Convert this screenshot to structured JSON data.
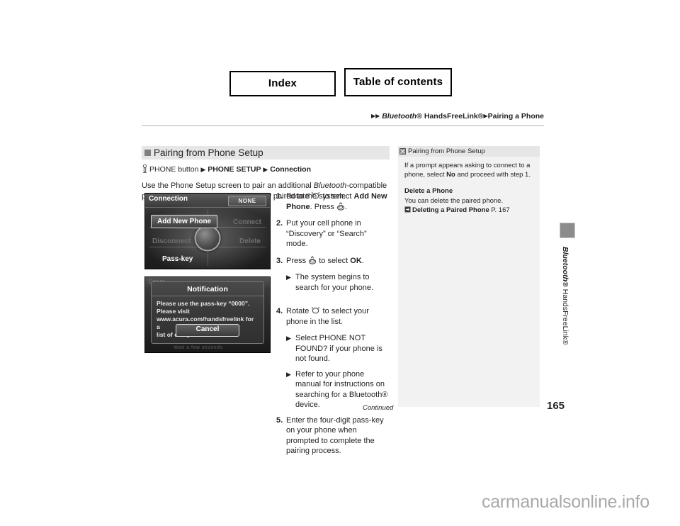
{
  "topnav": {
    "index_label": "Index",
    "toc_label": "Table of contents"
  },
  "breadcrumb": {
    "tri1": "▶",
    "tri2": "▶",
    "bluetooth": "Bluetooth",
    "reg1": "®",
    "handsfreelink": " HandsFreeLink",
    "reg2": "®",
    "tri3": "▶",
    "page": "Pairing a Phone"
  },
  "section": {
    "header_title": "Pairing from Phone Setup",
    "nav_phone_button": "PHONE button",
    "nav_tri1": "▶",
    "nav_phone_setup": "PHONE SETUP",
    "nav_tri2": "▶",
    "nav_connection": "Connection",
    "intro_a": "Use the Phone Setup screen to pair an additional ",
    "intro_italic": "Bluetooth",
    "intro_b": "-compatible phone if a phone has been previously paired to the system."
  },
  "screens": {
    "connection": {
      "title": "Connection",
      "status": "NONE",
      "btn_add_new_phone": "Add New Phone",
      "btn_connect": "Connect",
      "btn_disconnect": "Disconnect",
      "btn_delete": "Delete",
      "btn_pass_key": "Pass-key"
    },
    "notification": {
      "behind_title": "Setup",
      "title": "Notification",
      "line1": "Please use the pass-key “0000”.",
      "line2": "Please visit",
      "line3": "www.acura.com/handsfreelink for a",
      "line4": "list of compatible devices.",
      "cancel_label": "Cancel",
      "behind_bottom": "Wait a few seconds"
    }
  },
  "steps": [
    {
      "num": "1.",
      "pre": "Rotate ",
      "icon": "rotate-knob-icon",
      "mid": " to select ",
      "bold": "Add New Phone",
      "post": ". Press ",
      "icon2": "press-knob-icon",
      "end": "."
    },
    {
      "num": "2.",
      "text": "Put your cell phone in “Discovery” or “Search” mode."
    },
    {
      "num": "3.",
      "pre": "Press ",
      "icon": "press-knob-icon",
      "mid": " to select ",
      "bold": "OK",
      "post": ".",
      "sub": [
        {
          "tri": "▶",
          "text": "The system begins to search for your phone."
        }
      ]
    },
    {
      "num": "4.",
      "pre": "Rotate ",
      "icon": "rotate-knob-icon",
      "mid": " to select your phone in the list.",
      "sub": [
        {
          "tri": "▶",
          "pre": "Select ",
          "bold": "PHONE NOT FOUND?",
          "post": " if your phone is not found."
        },
        {
          "tri": "▶",
          "pre": "Refer to your phone manual for instructions on searching for a ",
          "italic": "Bluetooth",
          "post": "® device."
        }
      ]
    },
    {
      "num": "5.",
      "text": "Enter the four-digit pass-key on your phone when prompted to complete the pairing process."
    }
  ],
  "sidebar": {
    "header_title": "Pairing from Phone Setup",
    "body_a": "If a prompt appears asking to connect to a phone, select ",
    "body_bold": "No",
    "body_b": " and proceed with step 1.",
    "sub_title": "Delete a Phone",
    "sub_text": "You can delete the paired phone.",
    "ref_label": "Deleting a Paired Phone",
    "ref_page": " P. 167"
  },
  "edge": {
    "bluetooth": "Bluetooth",
    "reg1": "®",
    "handsfreelink": " HandsFreeLink",
    "reg2": "®"
  },
  "footer": {
    "continued": "Continued",
    "page_number": "165",
    "watermark": "carmanualsonline.info"
  },
  "colors": {
    "header_band": "#e6e6e6",
    "sidebar_bg": "#f2f2f2",
    "text": "#231f20",
    "rule": "#b3b3b3",
    "watermark": "#a9a9a9"
  }
}
